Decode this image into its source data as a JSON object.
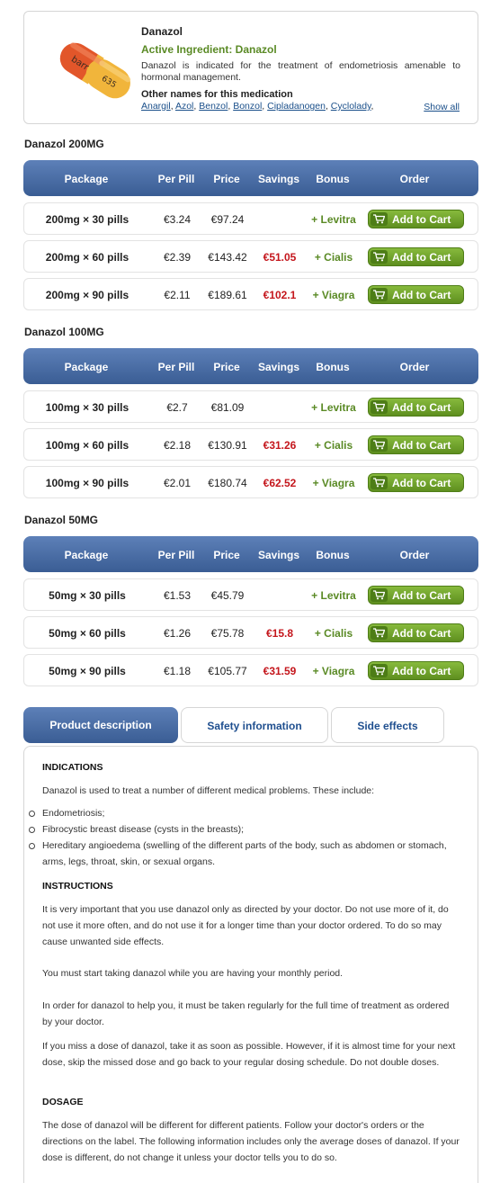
{
  "product": {
    "name": "Danazol",
    "active_ingredient": "Active Ingredient: Danazol",
    "description": "Danazol is indicated for the treatment of endometriosis amenable to hormonal management.",
    "other_names_heading": "Other names for this medication",
    "other_names": [
      "Anargil",
      "Azol",
      "Benzol",
      "Bonzol",
      "Cipladanogen",
      "Cyclolady"
    ],
    "other_names_trailing": ", ",
    "show_all": "Show all",
    "pill_imprint_top": "barr",
    "pill_imprint_bottom": "635"
  },
  "table_headers": {
    "package": "Package",
    "per_pill": "Per Pill",
    "price": "Price",
    "savings": "Savings",
    "bonus": "Bonus",
    "order": "Order"
  },
  "add_to_cart_label": "Add to Cart",
  "sections": [
    {
      "title": "Danazol 200MG",
      "rows": [
        {
          "package": "200mg × 30 pills",
          "per_pill": "€3.24",
          "price": "€97.24",
          "savings": "",
          "bonus": "+ Levitra"
        },
        {
          "package": "200mg × 60 pills",
          "per_pill": "€2.39",
          "price": "€143.42",
          "savings": "€51.05",
          "bonus": "+ Cialis"
        },
        {
          "package": "200mg × 90 pills",
          "per_pill": "€2.11",
          "price": "€189.61",
          "savings": "€102.1",
          "bonus": "+ Viagra"
        }
      ]
    },
    {
      "title": "Danazol 100MG",
      "rows": [
        {
          "package": "100mg × 30 pills",
          "per_pill": "€2.7",
          "price": "€81.09",
          "savings": "",
          "bonus": "+ Levitra"
        },
        {
          "package": "100mg × 60 pills",
          "per_pill": "€2.18",
          "price": "€130.91",
          "savings": "€31.26",
          "bonus": "+ Cialis"
        },
        {
          "package": "100mg × 90 pills",
          "per_pill": "€2.01",
          "price": "€180.74",
          "savings": "€62.52",
          "bonus": "+ Viagra"
        }
      ]
    },
    {
      "title": "Danazol 50MG",
      "rows": [
        {
          "package": "50mg × 30 pills",
          "per_pill": "€1.53",
          "price": "€45.79",
          "savings": "",
          "bonus": "+ Levitra"
        },
        {
          "package": "50mg × 60 pills",
          "per_pill": "€1.26",
          "price": "€75.78",
          "savings": "€15.8",
          "bonus": "+ Cialis"
        },
        {
          "package": "50mg × 90 pills",
          "per_pill": "€1.18",
          "price": "€105.77",
          "savings": "€31.59",
          "bonus": "+ Viagra"
        }
      ]
    }
  ],
  "tabs": [
    {
      "label": "Product description",
      "active": true
    },
    {
      "label": "Safety information",
      "active": false
    },
    {
      "label": "Side effects",
      "active": false
    }
  ],
  "description": {
    "indications_heading": "INDICATIONS",
    "indications_intro": "Danazol is used to treat a number of different medical problems. These include:",
    "indications_list": [
      "Endometriosis;",
      "Fibrocystic breast disease (cysts in the breasts);",
      "Hereditary angioedema (swelling of the different parts of the body, such as abdomen or stomach, arms, legs, throat, skin, or sexual organs."
    ],
    "instructions_heading": "INSTRUCTIONS",
    "instructions_p1": "It is very important that you use danazol only as directed by your doctor. Do not use more of it, do not use it more often, and do not use it for a longer time than your doctor ordered. To do so may cause unwanted side effects.",
    "instructions_p2": "You must start taking danazol while you are having your monthly period.",
    "instructions_p3": "In order for danazol to help you, it must be taken regularly for the full time of treatment as ordered by your doctor.",
    "instructions_p4": "If you miss a dose of danazol, take it as soon as possible. However, if it is almost time for your next dose, skip the missed dose and go back to your regular dosing schedule. Do not double doses.",
    "dosage_heading": "DOSAGE",
    "dosage_p1": "The dose of danazol will be different for different patients. Follow your doctor's orders or the directions on the label. The following information includes only the average doses of danazol. If your dose is different, do not change it unless your doctor tells you to do so."
  },
  "colors": {
    "header_blue": "#3a5d94",
    "bonus_green": "#5a8a25",
    "savings_red": "#c4161c",
    "button_green": "#6fa22b"
  }
}
